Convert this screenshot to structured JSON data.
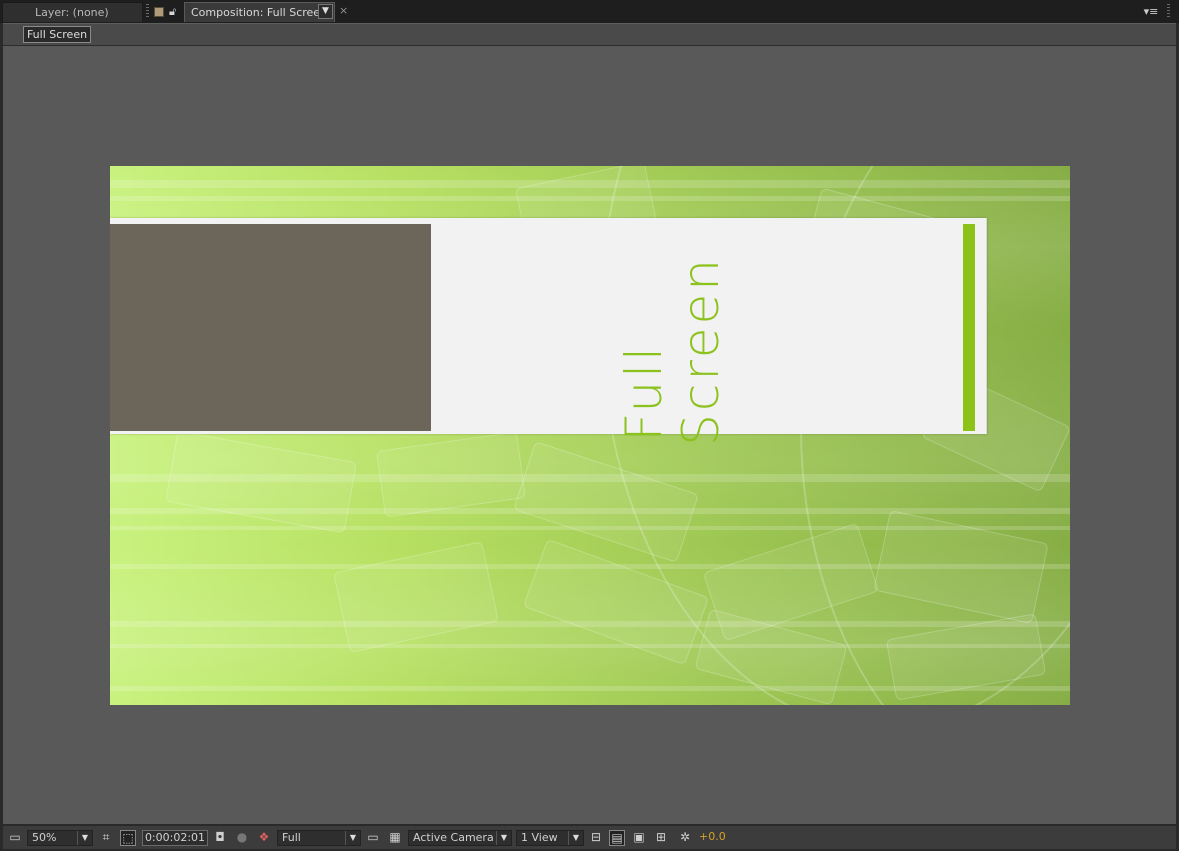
{
  "tabs": {
    "layer_tab": "Layer: (none)",
    "comp_tab": "Composition: Full Screen",
    "comp_dropdown_arrow": "▼",
    "close_glyph": "×",
    "panel_menu_glyph": "▾≡"
  },
  "subbar": {
    "comp_name": "Full Screen"
  },
  "composition": {
    "headline_line1": "Full",
    "headline_line2": "Screen",
    "colors": {
      "background_light": "#c8f27e",
      "background_dark": "#86ae45",
      "panel": "#f2f2f2",
      "photo_placeholder": "#6b655a",
      "accent": "#8dc218"
    }
  },
  "bottombar": {
    "zoom": "50%",
    "timecode": "0:00:02:01",
    "resolution": "Full",
    "camera": "Active Camera",
    "views": "1 View",
    "exposure": "+0.0",
    "dropdown_arrow": "▼",
    "icons": {
      "region": "▣",
      "grid": "⌗",
      "safe": "⬚",
      "snapshot": "◘",
      "show_snapshot": "●",
      "channel": "❖",
      "fast_preview": "▭",
      "transparency": "▦",
      "flowchart": "⛁",
      "timeline": "▤",
      "pixel_aspect": "⊟",
      "flow": "⊞",
      "reset_exposure": "✲"
    }
  }
}
